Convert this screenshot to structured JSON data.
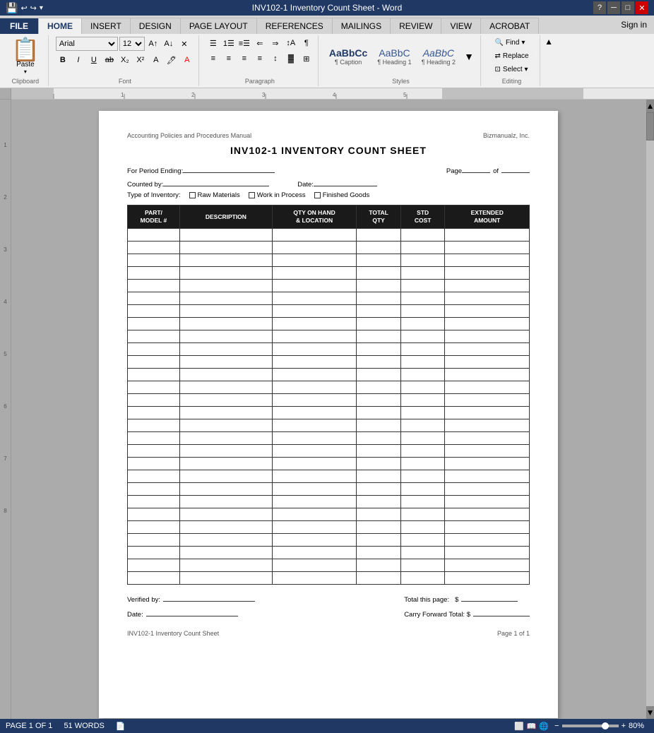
{
  "titlebar": {
    "title": "INV102-1 Inventory Count Sheet - Word",
    "help": "?",
    "minimize": "─",
    "maximize": "□",
    "close": "✕"
  },
  "ribbon": {
    "tabs": [
      "FILE",
      "HOME",
      "INSERT",
      "DESIGN",
      "PAGE LAYOUT",
      "REFERENCES",
      "MAILINGS",
      "REVIEW",
      "VIEW",
      "ACROBAT"
    ],
    "active_tab": "HOME",
    "sign_in": "Sign in",
    "groups": {
      "clipboard": "Clipboard",
      "font": "Font",
      "paragraph": "Paragraph",
      "styles": "Styles",
      "editing": "Editing"
    },
    "font": {
      "name": "Arial",
      "size": "12"
    },
    "styles": {
      "items": [
        {
          "label": "AaBbCc",
          "name": "Caption"
        },
        {
          "label": "AaBbC",
          "name": "Heading 1"
        },
        {
          "label": "AaBbC",
          "name": "Heading 2"
        }
      ]
    },
    "editing": {
      "find": "Find",
      "replace": "Replace",
      "select": "Select ▾"
    }
  },
  "document": {
    "header_left": "Accounting Policies and Procedures Manual",
    "header_right": "Bizmanualz, Inc.",
    "title": "INV102-1 INVENTORY COUNT SHEET",
    "period_ending_label": "For Period Ending:",
    "page_label": "Page",
    "of_label": "of",
    "counted_by_label": "Counted by:",
    "date_label": "Date:",
    "type_label": "Type of Inventory:",
    "types": [
      "Raw Materials",
      "Work in Process",
      "Finished Goods"
    ],
    "table": {
      "headers": [
        "PART/\nMODEL #",
        "DESCRIPTION",
        "QTY ON HAND\n& LOCATION",
        "TOTAL\nQTY",
        "STD\nCOST",
        "EXTENDED\nAMOUNT"
      ],
      "col_widths": [
        "13%",
        "22%",
        "21%",
        "11%",
        "11%",
        "22%"
      ],
      "row_count": 28
    },
    "footer": {
      "verified_by": "Verified by:",
      "date": "Date:",
      "total_this_page": "Total this page:",
      "carry_forward": "Carry Forward Total: $",
      "dollar_sign": "$"
    },
    "page_footer_left": "INV102-1 Inventory Count Sheet",
    "page_footer_right": "Page 1 of 1"
  },
  "statusbar": {
    "page": "PAGE 1 OF 1",
    "words": "51 WORDS",
    "zoom": "80%"
  }
}
